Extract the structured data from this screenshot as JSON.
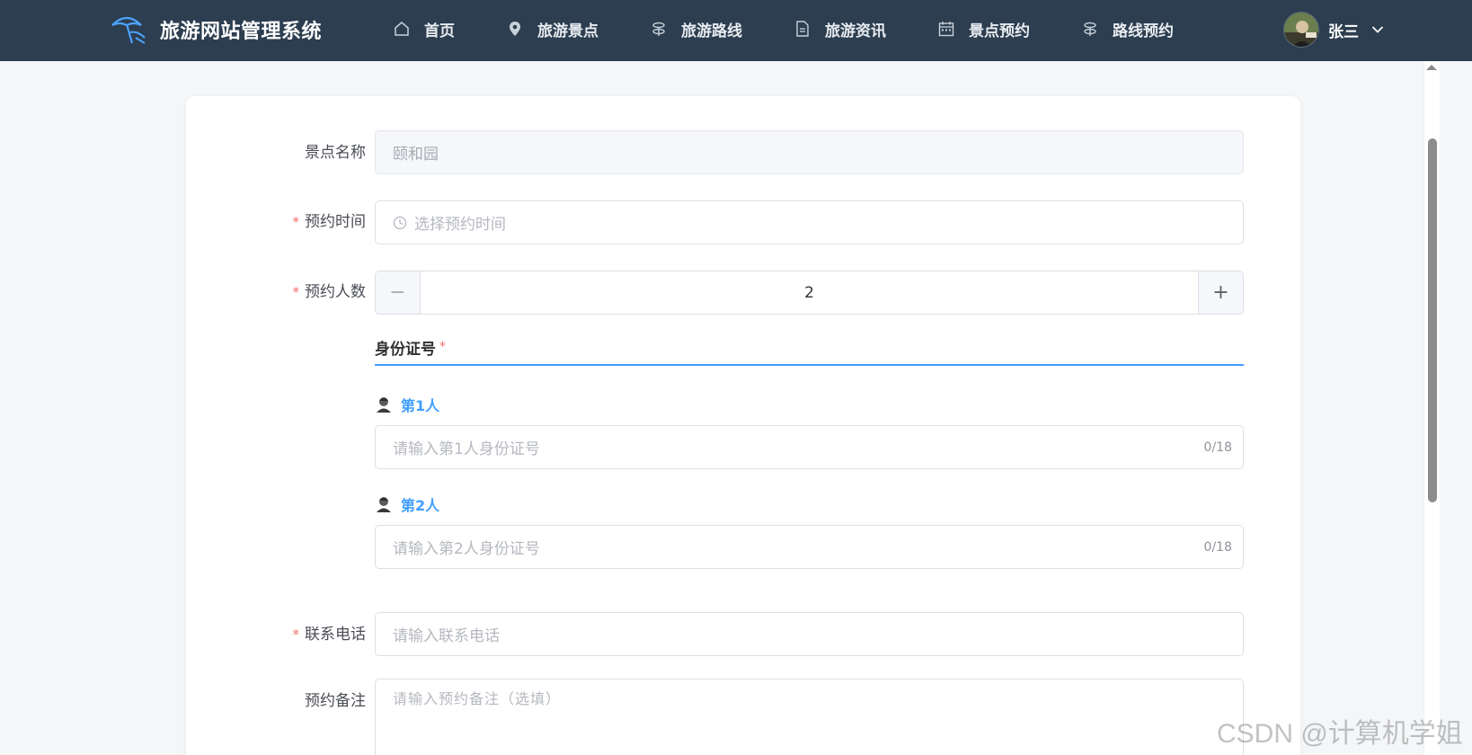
{
  "header": {
    "brand_title": "旅游网站管理系统",
    "brand_icon": "beach-umbrella-icon",
    "nav": [
      {
        "label": "首页",
        "icon": "home-icon"
      },
      {
        "label": "旅游景点",
        "icon": "location-icon"
      },
      {
        "label": "旅游路线",
        "icon": "route-icon"
      },
      {
        "label": "旅游资讯",
        "icon": "document-icon"
      },
      {
        "label": "景点预约",
        "icon": "calendar-icon"
      },
      {
        "label": "路线预约",
        "icon": "route-icon"
      }
    ],
    "user": {
      "name": "张三",
      "icon": "chevron-down-icon"
    }
  },
  "form": {
    "spot_name": {
      "label": "景点名称",
      "value": "颐和园"
    },
    "booking_time": {
      "label": "预约时间",
      "required_mark": "*",
      "placeholder": "选择预约时间",
      "icon": "clock-icon"
    },
    "people_count": {
      "label": "预约人数",
      "required_mark": "*",
      "value": "2",
      "minus": "−",
      "plus": "+"
    },
    "id_section": {
      "title": "身份证号",
      "required_mark": "*",
      "persons": [
        {
          "label": "第1人",
          "placeholder": "请输入第1人身份证号",
          "counter": "0/18",
          "icon": "user-icon"
        },
        {
          "label": "第2人",
          "placeholder": "请输入第2人身份证号",
          "counter": "0/18",
          "icon": "user-icon"
        }
      ]
    },
    "phone": {
      "label": "联系电话",
      "required_mark": "*",
      "placeholder": "请输入联系电话"
    },
    "remark": {
      "label": "预约备注",
      "placeholder": "请输入预约备注（选填）"
    }
  },
  "watermark": "CSDN @计算机学姐",
  "colors": {
    "topbar": "#2c3e50",
    "accent": "#409eff",
    "required": "#f56c6c"
  }
}
